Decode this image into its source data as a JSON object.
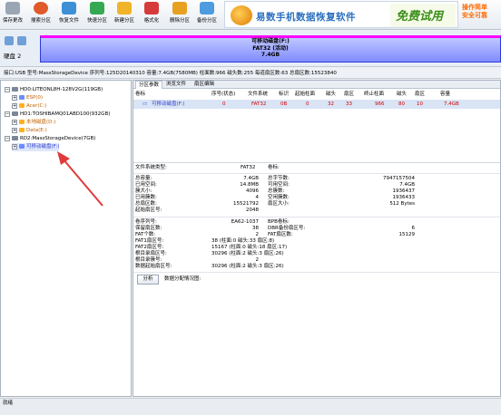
{
  "toolbar": {
    "buttons": [
      {
        "label": "保存更改",
        "icon": "save-icon",
        "color": "#9aa6b3"
      },
      {
        "label": "搜索分区",
        "icon": "magnifier-icon",
        "color": "#e05a2a"
      },
      {
        "label": "恢复文件",
        "icon": "recover-file-icon",
        "color": "#3d8fd6"
      },
      {
        "label": "快速分区",
        "icon": "quick-partition-icon",
        "color": "#36a852"
      },
      {
        "label": "新建分区",
        "icon": "new-partition-icon",
        "color": "#f0b429"
      },
      {
        "label": "格式化",
        "icon": "format-icon",
        "color": "#d63b3b"
      },
      {
        "label": "删除分区",
        "icon": "delete-partition-icon",
        "color": "#e8a020"
      },
      {
        "label": "备份分区",
        "icon": "backup-partition-icon",
        "color": "#4e9be0"
      }
    ]
  },
  "banner": {
    "title": "易数手机数据恢复软件",
    "stamp": "免费试用",
    "tag1": "操作简单",
    "tag2": "安全可靠"
  },
  "disk_panel": {
    "disk_label": "硬盘 2",
    "partition_name": "可移动磁盘(F:)",
    "partition_fs": "FAT32 (活动)",
    "partition_size": "7.4GB"
  },
  "info_bar": "接口:USB  型号:MassStorageDevice  序列号:125D20140310  容量:7.4GB(7580MB)  柱面数:966  磁头数:255  每道扇区数:63  总扇区数:15523840",
  "tree": {
    "items": [
      {
        "label": "HD0:LITEONL8H-128V2G(119GB)",
        "level": 0,
        "kind": "disk",
        "expander": "−"
      },
      {
        "label": "ESP(0)",
        "level": 1,
        "kind": "part-blue",
        "expander": "+"
      },
      {
        "label": "Acer(C:)",
        "level": 1,
        "kind": "part",
        "expander": "+"
      },
      {
        "label": "HD1:TOSHIBAMQ01ABD100(932GB)",
        "level": 0,
        "kind": "disk",
        "expander": "−"
      },
      {
        "label": "本地磁盘(D:)",
        "level": 1,
        "kind": "part",
        "expander": "+"
      },
      {
        "label": "Data(E:)",
        "level": 1,
        "kind": "part",
        "expander": "+"
      },
      {
        "label": "RD2:MassStorageDevice(7GB)",
        "level": 0,
        "kind": "disk",
        "expander": "−"
      },
      {
        "label": "可移动磁盘(F:)",
        "level": 1,
        "kind": "part-blue",
        "expander": "+"
      }
    ]
  },
  "tabs": [
    "分区参数",
    "浏览文件",
    "扇区编辑"
  ],
  "partition_table": {
    "headers": [
      "卷标",
      "序号(状态)",
      "文件系统",
      "标识",
      "起始柱面",
      "磁头",
      "扇区",
      "终止柱面",
      "磁头",
      "扇区",
      "容量"
    ],
    "row": [
      "可移动磁盘(F:)",
      "0",
      "FAT32",
      "0B",
      "0",
      "32",
      "33",
      "966",
      "80",
      "10",
      "7.4GB"
    ]
  },
  "details": {
    "fs_type_label": "文件系统类型:",
    "fs_type_value": "FAT32",
    "volume_label_label": "卷标:",
    "left_block": [
      {
        "k": "总容量:",
        "v": "7.4GB"
      },
      {
        "k": "已用空间:",
        "v": "14.8MB"
      },
      {
        "k": "簇大小:",
        "v": "4096"
      },
      {
        "k": "已用簇数:",
        "v": "4"
      },
      {
        "k": "总扇区数:",
        "v": "15521792"
      },
      {
        "k": "起始扇区号:",
        "v": "2048"
      }
    ],
    "right_block": [
      {
        "k": "总字节数:",
        "v": "7947157504"
      },
      {
        "k": "可用空间:",
        "v": "7.4GB"
      },
      {
        "k": "总簇数:",
        "v": "1936437"
      },
      {
        "k": "空闲簇数:",
        "v": "1936433"
      },
      {
        "k": "扇区大小:",
        "v": "512 Bytes"
      }
    ],
    "lower_left": [
      {
        "k": "卷序列号:",
        "v": "EA62-1037"
      },
      {
        "k": "保留扇区数:",
        "v": "38"
      },
      {
        "k": "FAT个数:",
        "v": "2"
      },
      {
        "k": "FAT1扇区号:",
        "v": "38 (柱面:0 磁头:33 扇区:8)"
      },
      {
        "k": "FAT2扇区号:",
        "v": "15167 (柱面:0 磁头:18 扇区:17)"
      },
      {
        "k": "根目录扇区号:",
        "v": "30296 (柱面:2 磁头:3 扇区:26)"
      },
      {
        "k": "根目录簇号:",
        "v": "2"
      },
      {
        "k": "数据起始扇区号:",
        "v": "30296 (柱面:2 磁头:3 扇区:26)"
      }
    ],
    "lower_right": [
      {
        "k": "BPB卷标:",
        "v": ""
      },
      {
        "k": "DBR备份扇区号:",
        "v": "6"
      },
      {
        "k": "FAT扇区数:",
        "v": "15129"
      }
    ],
    "analyze_button": "分析",
    "distribution_label": "数据分配情况图:"
  },
  "status": "就绪"
}
